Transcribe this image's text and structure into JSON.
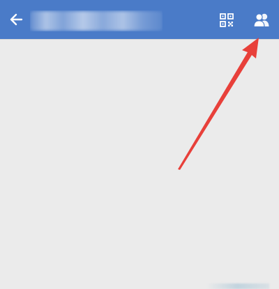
{
  "header": {
    "background_color": "#4a7bc8",
    "back_icon": "arrow-left-icon",
    "title": "",
    "qr_icon": "qr-code-icon",
    "contacts_icon": "contacts-icon"
  },
  "annotation": {
    "type": "red-arrow",
    "color": "#e8403a",
    "points_to": "contacts-button"
  },
  "content": {
    "background_color": "#ebebeb"
  }
}
